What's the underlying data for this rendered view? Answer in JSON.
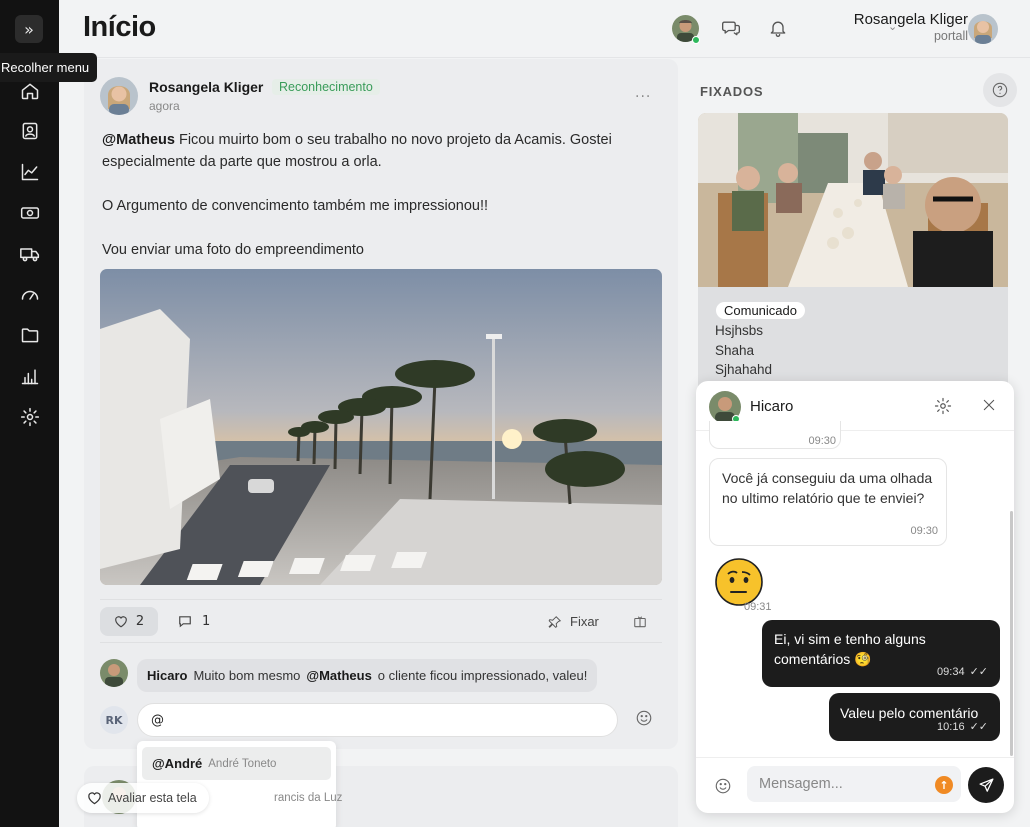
{
  "sidebar": {
    "toggle_icon": "double-chevron-right-icon",
    "tooltip": "Recolher menu",
    "items": [
      "home-icon",
      "contacts-icon",
      "chart-line-icon",
      "money-icon",
      "truck-icon",
      "gauge-icon",
      "folder-icon",
      "bar-chart-icon",
      "gear-icon"
    ]
  },
  "header": {
    "title": "Início",
    "user_name": "Rosangela Kliger",
    "user_role": "portall",
    "chevron": "⌄"
  },
  "post": {
    "author": "Rosangela Kliger",
    "tag": "Reconhecimento",
    "time": "agora",
    "more": "...",
    "mention": "@Matheus",
    "line1_rest": " Ficou muirto bom o seu trabalho no novo projeto da Acamis. Gostei especialmente da parte que mostrou a orla.",
    "line2": "O Argumento de convencimento também me impressionou!!",
    "line3": "Vou enviar uma foto do empreendimento",
    "likes": "2",
    "comments": "1",
    "pin_label": "Fixar"
  },
  "comment": {
    "author": "Hicaro",
    "text_before": "Muito bom mesmo",
    "mention": "@Matheus",
    "text_after": "o cliente ficou impressionado, valeu!"
  },
  "reply": {
    "initials": "RK",
    "value": "@"
  },
  "mention_dropdown": {
    "items": [
      {
        "handle": "@André",
        "name": "André Toneto"
      },
      {
        "handle": "",
        "name": "rancis da Luz"
      }
    ]
  },
  "rate_button": "Avaliar esta tela",
  "pinned": {
    "title": "FIXADOS",
    "badge": "Comunicado",
    "lines": [
      "Hsjhsbs",
      "Shaha",
      "Sjhahahd"
    ]
  },
  "chat": {
    "contact": "Hicaro",
    "messages": [
      {
        "dir": "in",
        "text": "",
        "time": "09:30"
      },
      {
        "dir": "in",
        "text": "Você já conseguiu da uma olhada no ultimo relatório que te enviei?",
        "time": "09:30"
      },
      {
        "dir": "in",
        "text": "🤨",
        "time": "09:31"
      },
      {
        "dir": "out",
        "text": "Ei, vi sim e tenho alguns comentários 🧐",
        "time": "09:34"
      },
      {
        "dir": "out",
        "text": "Valeu pelo comentário",
        "time": "10:16"
      }
    ],
    "input_placeholder": "Mensagem..."
  },
  "colors": {
    "sidebar_bg": "#121212",
    "accent_green": "#3a9c5a",
    "online": "#2eb85c",
    "dark_bubble": "#1c1c1c",
    "orange": "#f08a24"
  }
}
